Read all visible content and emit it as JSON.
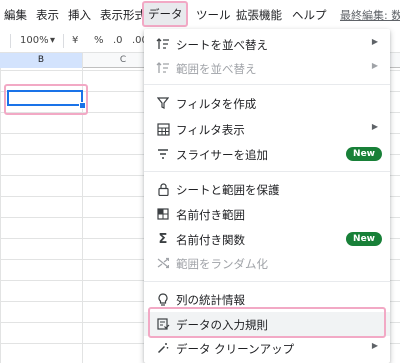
{
  "menubar": {
    "items": [
      "編集",
      "表示",
      "挿入",
      "表示形式",
      "データ",
      "ツール",
      "拡張機能",
      "ヘルプ"
    ],
    "active_index": 4,
    "last_edit": "最終編集: 数"
  },
  "toolbar": {
    "zoom": "100%",
    "currency": "¥",
    "percent": "%",
    "decimal_decrease": ".0",
    "decimal_increase": ".00"
  },
  "sheet": {
    "columns": [
      "B",
      "C"
    ]
  },
  "data_menu": {
    "items": [
      {
        "label": "シートを並べ替え",
        "icon": "sort-icon",
        "submenu": true,
        "enabled": true
      },
      {
        "label": "範囲を並べ替え",
        "icon": "sort-range-icon",
        "submenu": true,
        "enabled": false
      },
      {
        "label": "フィルタを作成",
        "icon": "filter-icon",
        "enabled": true
      },
      {
        "label": "フィルタ表示",
        "icon": "filter-views-icon",
        "submenu": true,
        "enabled": true
      },
      {
        "label": "スライサーを追加",
        "icon": "slicer-icon",
        "badge": "New",
        "enabled": true
      },
      {
        "label": "シートと範囲を保護",
        "icon": "lock-icon",
        "enabled": true
      },
      {
        "label": "名前付き範囲",
        "icon": "named-range-icon",
        "enabled": true
      },
      {
        "label": "名前付き関数",
        "icon": "sigma-icon",
        "badge": "New",
        "enabled": true
      },
      {
        "label": "範囲をランダム化",
        "icon": "shuffle-icon",
        "enabled": false
      },
      {
        "label": "列の統計情報",
        "icon": "lightbulb-icon",
        "enabled": true
      },
      {
        "label": "データの入力規則",
        "icon": "data-validation-icon",
        "enabled": true,
        "highlighted": true
      },
      {
        "label": "データ クリーンアップ",
        "icon": "magic-wand-icon",
        "submenu": true,
        "enabled": true
      }
    ]
  },
  "colors": {
    "highlight": "#f2a9c5",
    "selection": "#1a73e8",
    "badge_bg": "#188038"
  }
}
